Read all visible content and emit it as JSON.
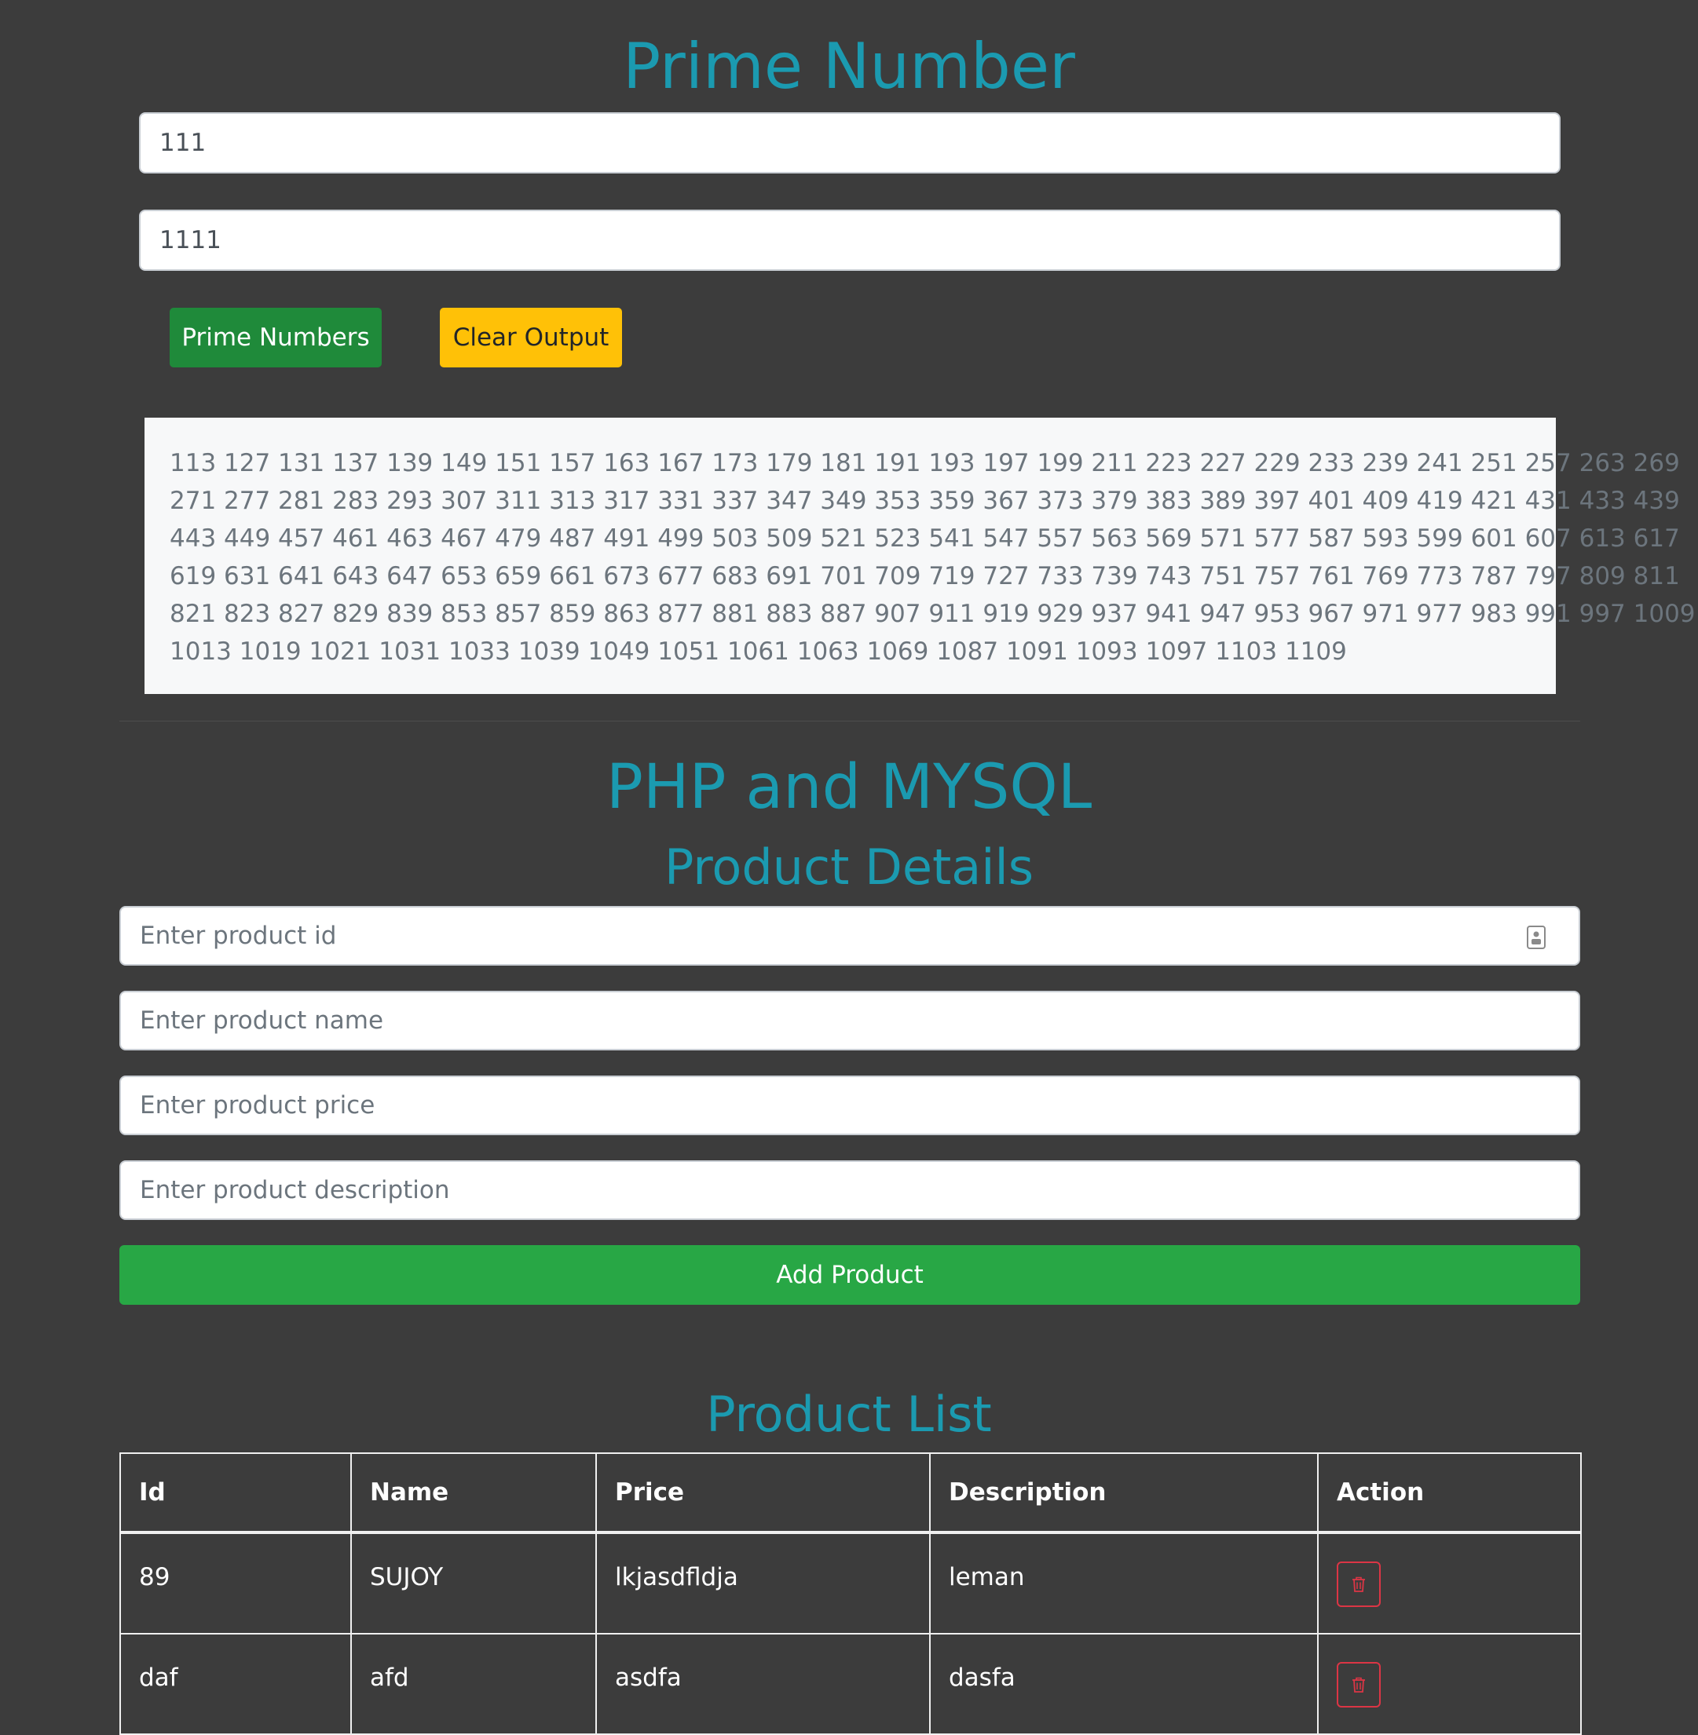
{
  "prime_section": {
    "title": "Prime Number",
    "start_value": "111",
    "end_value": "1111",
    "prime_button_label": "Prime Numbers",
    "clear_button_label": "Clear Output",
    "output_lines": [
      "113 127 131 137 139 149 151 157 163 167 173 179 181 191 193 197 199 211 223 227 229 233 239 241 251 257 263 269",
      "271 277 281 283 293 307 311 313 317 331 337 347 349 353 359 367 373 379 383 389 397 401 409 419 421 431 433 439",
      "443 449 457 461 463 467 479 487 491 499 503 509 521 523 541 547 557 563 569 571 577 587 593 599 601 607 613 617",
      "619 631 641 643 647 653 659 661 673 677 683 691 701 709 719 727 733 739 743 751 757 761 769 773 787 797 809 811",
      "821 823 827 829 839 853 857 859 863 877 881 883 887 907 911 919 929 937 941 947 953 967 971 977 983 991 997 1009",
      "1013 1019 1021 1031 1033 1039 1049 1051 1061 1063 1069 1087 1091 1093 1097 1103 1109"
    ]
  },
  "product_section": {
    "title": "PHP and MYSQL",
    "subtitle": "Product Details",
    "form": {
      "id_placeholder": "Enter product id",
      "id_icon": "contact-card-icon",
      "name_placeholder": "Enter product name",
      "price_placeholder": "Enter product price",
      "description_placeholder": "Enter product description",
      "add_button_label": "Add Product"
    },
    "list_title": "Product List",
    "table": {
      "headers": [
        "Id",
        "Name",
        "Price",
        "Description",
        "Action"
      ],
      "rows": [
        {
          "id": "89",
          "name": "SUJOY",
          "price": "lkjasdfldja",
          "description": "leman",
          "action_icon": "trash-icon"
        },
        {
          "id": "daf",
          "name": "afd",
          "price": "asdfa",
          "description": "dasfa",
          "action_icon": "trash-icon"
        }
      ]
    }
  },
  "colors": {
    "background": "#3c3c3c",
    "title": "#1b9ab0",
    "success": "#28a745",
    "warning": "#ffc107",
    "danger": "#dc3545"
  }
}
